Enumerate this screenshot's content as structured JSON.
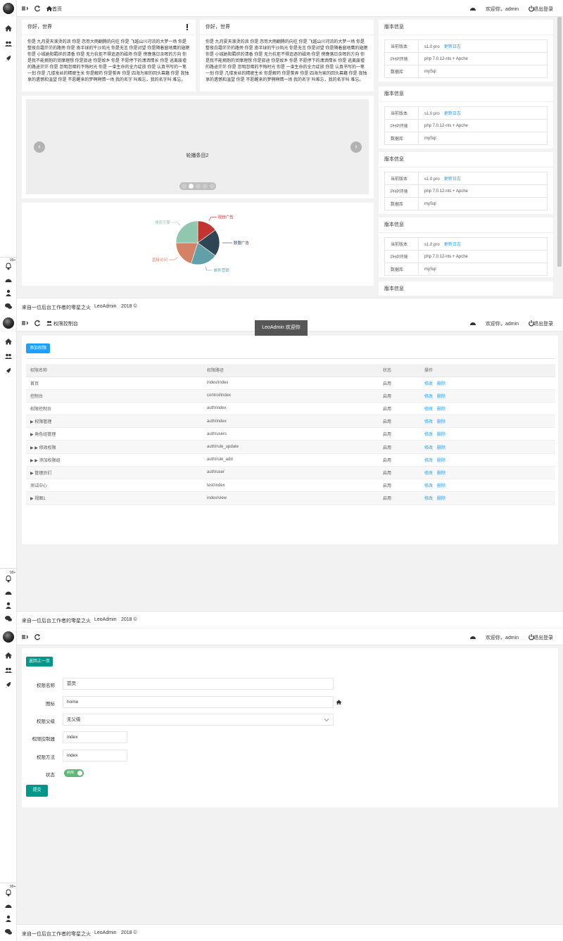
{
  "footer": {
    "text": "来自一位后台工作者的零星之火",
    "brand": "LeoAdmin",
    "year": "2018 ©"
  },
  "topbar": {
    "welcome": "欢迎你，admin",
    "logout": "退出登录"
  },
  "sidebar": {
    "badge": "99+"
  },
  "panel1": {
    "breadcrumb": "首页",
    "hello_cards": [
      {
        "title": "你好，世界",
        "text": "你是 九月夏天滚烫的浪 你是 忽而大雨翻腾的向往 你是 飞越山川河流的大梦一场 你是 整夜白霜茫茫的路旁 你是 南半球的牛沙风光 你是无言 你是对望 你是隔着窗地鹰的翅膀 你是 小城她阳羁绊的清香 你是 无力抗拒不得追逐的磁场 你是 傍晚落日余晖的方向 你是我不能拥抱的贸摩理想 你是旅途 你是故乡 你是 不愿停下的潇洒情长 你是 逃离废墟的路途茫茫 你是 忽明忽暗的不悔时光 你是 一束生命的全力绽放 你是 认真书写的一笔一划 你是 几缕发丝的精疲生长 你是解药 你是誓弄 你是 四海为家的回头幕籍 你是 我独享的遗憾和温望 你是 不愿醒来的梦啊啊情一场 我的名字 叫难忘，我的名字叫 难忘。",
        "has_alert_icon": true
      },
      {
        "title": "你好，世界",
        "text": "你是 九月夏天滚烫的浪 你是 忽而大雨翻腾的向往 你是 飞越山川河流的大梦一场 你是 整夜白霜茫茫的路旁 你是 南半球的牛沙风光 你是无言 你是对望 你是隔着窗地鹰的翅膀 你是 小城她阳羁绊的清香 你是 无力抗拒不得追逐的磁场 你是 傍晚落日余晖的方向 你是我不能拥抱的贸摩理想 你是旅途 你是故乡 你是 不愿停下的潇洒情长 你是 逃离废墟的路途茫茫 你是 忽明忽暗的不悔时光 你是 一束生命的全力绽放 你是 认真书写的一笔一划 你是 几缕发丝的精疲生长 你是解药 你是誓弄 你是 四海为家的回头幕籍 你是 我独享的遗憾和温望 你是 不愿醒来的梦啊啊情一场 我的名字 叫难忘，我的名字叫 难忘。",
        "has_alert_icon": false
      }
    ],
    "carousel": {
      "label": "轮播条目2",
      "prev": "‹",
      "next": "›"
    },
    "version_cards": [
      {
        "title": "版本信息",
        "rows": [
          {
            "key": "当前版本",
            "value": "s1.0 pro",
            "link": "更新日志"
          },
          {
            "key": "PHP环境",
            "value": "php 7.0.12-nts + Apche",
            "link": ""
          },
          {
            "key": "数据库",
            "value": "mySql",
            "link": ""
          }
        ]
      },
      {
        "title": "版本信息",
        "rows": [
          {
            "key": "当前版本",
            "value": "s1.0 pro",
            "link": "更新日志"
          },
          {
            "key": "PHP环境",
            "value": "php 7.0.12-nts + Apche",
            "link": ""
          },
          {
            "key": "数据库",
            "value": "mySql",
            "link": ""
          }
        ]
      },
      {
        "title": "版本信息",
        "rows": [
          {
            "key": "当前版本",
            "value": "s1.0 pro",
            "link": "更新日志"
          },
          {
            "key": "PHP环境",
            "value": "php 7.0.12-nts + Apche",
            "link": ""
          },
          {
            "key": "数据库",
            "value": "mySql",
            "link": ""
          }
        ]
      },
      {
        "title": "版本信息",
        "rows": [
          {
            "key": "当前版本",
            "value": "s1.0 pro",
            "link": "更新日志"
          },
          {
            "key": "PHP环境",
            "value": "php 7.0.12-nts + Apche",
            "link": ""
          },
          {
            "key": "数据库",
            "value": "mySql",
            "link": ""
          }
        ]
      }
    ],
    "last_card_title": "版本信息"
  },
  "chart_data": {
    "type": "pie",
    "title": "",
    "slices": [
      {
        "name": "视频广告",
        "value": 15,
        "color": "#c23531"
      },
      {
        "name": "联盟广告",
        "value": 20,
        "color": "#2f4554"
      },
      {
        "name": "邮件营销",
        "value": 20,
        "color": "#61a0a8"
      },
      {
        "name": "直接访问",
        "value": 20,
        "color": "#d48265"
      },
      {
        "name": "搜索引擎",
        "value": 25,
        "color": "#91c7ae"
      }
    ]
  },
  "panel2": {
    "breadcrumb": "权限控制台",
    "toast": "LeoAdmin 欢迎你",
    "add_button": "添加权限",
    "columns": [
      "权限名称",
      "权限路径",
      "状态",
      "操作"
    ],
    "edit_label": "修改",
    "delete_label": "删除",
    "rows": [
      {
        "name": "首页",
        "path": "index/index",
        "status": "启用"
      },
      {
        "name": "控制台",
        "path": "control/index",
        "status": "启用"
      },
      {
        "name": "权限控制台",
        "path": "auth/index",
        "status": "启用"
      },
      {
        "name": "▶ 权限管理",
        "path": "auth/index",
        "status": "启用"
      },
      {
        "name": "▶ 角色组管理",
        "path": "auth/users",
        "status": "启用"
      },
      {
        "name": "▶ ▶ 修改权限",
        "path": "auth/rule_update",
        "status": "启用"
      },
      {
        "name": "▶ ▶ 添加权限组",
        "path": "auth/rule_add",
        "status": "启用"
      },
      {
        "name": "▶ 管理员们",
        "path": "auth/user",
        "status": "启用"
      },
      {
        "name": "测试中心",
        "path": "test/index",
        "status": "启用"
      },
      {
        "name": "▶ 视图1",
        "path": "index/view",
        "status": "启用"
      }
    ]
  },
  "panel3": {
    "back_button": "返回上一页",
    "fields": {
      "name_label": "权限名称",
      "name_value": "首页",
      "icon_label": "图标",
      "icon_value": "home",
      "parent_label": "权限父级",
      "parent_value": "无父级",
      "controller_label": "权限控制器",
      "controller_value": "index",
      "method_label": "权限方法",
      "method_value": "index",
      "status_label": "状态",
      "status_value": "启用"
    },
    "submit_button": "提交"
  }
}
